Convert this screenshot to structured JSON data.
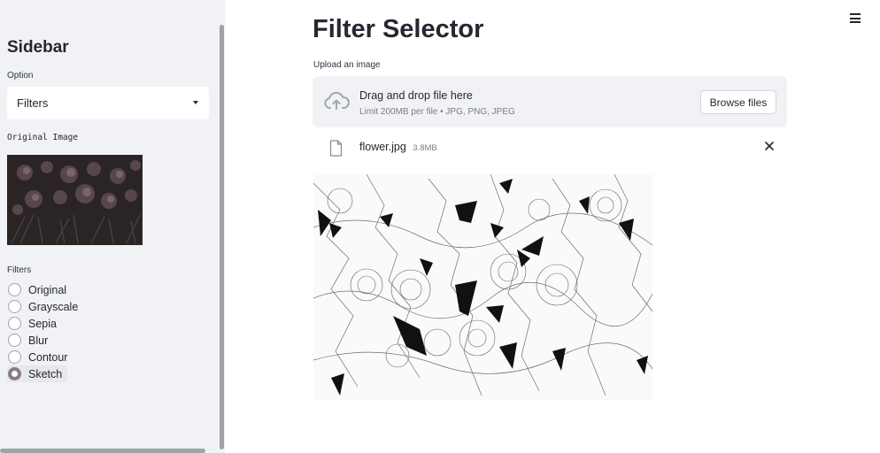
{
  "sidebar": {
    "title": "Sidebar",
    "option_label": "Option",
    "option_selected": "Filters",
    "original_image_label": "Original Image",
    "filters_label": "Filters",
    "filters": [
      {
        "label": "Original",
        "selected": false
      },
      {
        "label": "Grayscale",
        "selected": false
      },
      {
        "label": "Sepia",
        "selected": false
      },
      {
        "label": "Blur",
        "selected": false
      },
      {
        "label": "Contour",
        "selected": false
      },
      {
        "label": "Sketch",
        "selected": true
      }
    ]
  },
  "main": {
    "title": "Filter Selector",
    "upload_label": "Upload an image",
    "dropzone": {
      "title": "Drag and drop file here",
      "subtitle": "Limit 200MB per file • JPG, PNG, JPEG",
      "browse_label": "Browse files"
    },
    "file": {
      "name": "flower.jpg",
      "size": "3.8MB"
    }
  },
  "icons": {
    "menu": "hamburger-menu-icon",
    "upload": "cloud-upload-icon",
    "file": "file-icon",
    "remove": "close-icon",
    "dropdown": "chevron-down-icon"
  },
  "colors": {
    "sidebar_bg": "#f0f2f6",
    "text": "#262730",
    "radio_selected": "#8a7c80"
  }
}
